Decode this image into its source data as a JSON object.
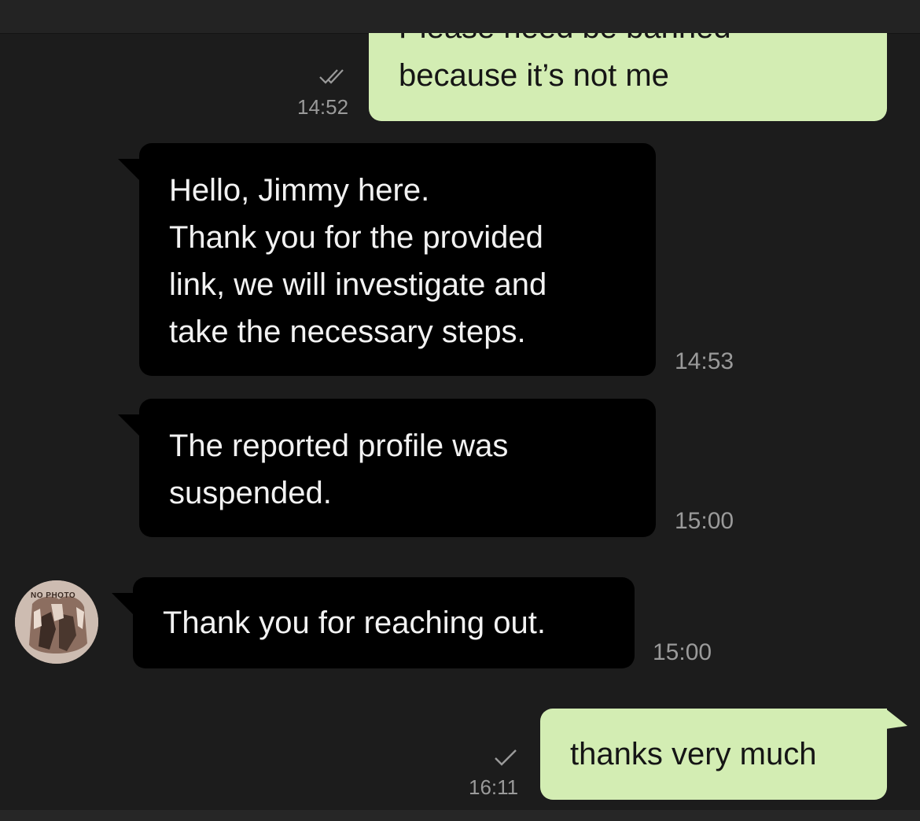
{
  "messages": [
    {
      "direction": "outgoing",
      "cut_line": "Please need be banned",
      "text": "because it’s not me",
      "time": "14:52",
      "status_icon": "double-check-icon"
    },
    {
      "direction": "incoming",
      "lines": [
        "Hello, Jimmy here.",
        "Thank you for the provided",
        "link, we will investigate and",
        "take the necessary steps."
      ],
      "time": "14:53"
    },
    {
      "direction": "incoming",
      "lines": [
        "The reported profile was",
        "suspended."
      ],
      "time": "15:00"
    },
    {
      "direction": "incoming",
      "text": "Thank you for reaching out.",
      "time": "15:00",
      "avatar_label": "NO PHOTO"
    },
    {
      "direction": "outgoing",
      "text": "thanks very much",
      "time": "16:11",
      "status_icon": "single-check-icon"
    }
  ],
  "colors": {
    "background": "#1c1c1c",
    "outgoing_bubble": "#d3edb3",
    "incoming_bubble": "#000000",
    "timestamp": "#9a9a9a"
  }
}
